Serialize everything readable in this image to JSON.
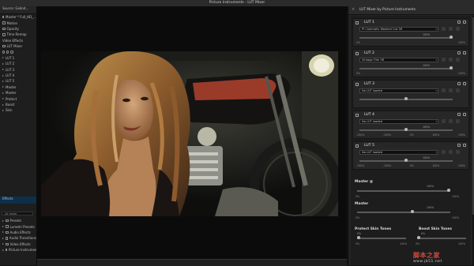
{
  "window": {
    "title": "Picture Instruments - LUT Mixer"
  },
  "left_panel": {
    "header": "Source: Geänd...",
    "items": [
      {
        "label": "Master * Full_HD_...",
        "kind": "fx"
      },
      {
        "label": "Motion",
        "kind": "fx"
      },
      {
        "label": "Opacity",
        "kind": "fx"
      },
      {
        "label": "Time Remap",
        "kind": "fx"
      },
      {
        "label": "Video Effects",
        "kind": "text"
      },
      {
        "label": "LUT Mixer",
        "kind": "fx"
      },
      {
        "label": "",
        "kind": "circles"
      },
      {
        "label": "LUT 1",
        "kind": "tri"
      },
      {
        "label": "LUT 2",
        "kind": "tri"
      },
      {
        "label": "LUT 3",
        "kind": "tri"
      },
      {
        "label": "LUT 4",
        "kind": "tri"
      },
      {
        "label": "LUT 5",
        "kind": "tri"
      },
      {
        "label": "Master",
        "kind": "tri"
      },
      {
        "label": "Master",
        "kind": "tri"
      },
      {
        "label": "Protect",
        "kind": "tri"
      },
      {
        "label": "Boost",
        "kind": "tri"
      },
      {
        "label": "Skin",
        "kind": "tri"
      }
    ],
    "lower_header": "Effects",
    "search_value": "lut mixer",
    "lower_items": [
      "Presets",
      "Lumetri Presets",
      "Audio Effects",
      "Audio Transitions",
      "Video Effects",
      "Picture Instruments"
    ]
  },
  "right_panel": {
    "title": "LUT Mixer by Picture Instruments",
    "close_glyph": "×",
    "luts": [
      {
        "name": "LUT 1",
        "selected": "PI Cinematic Washed Out 5R",
        "pct_top": "100%",
        "level": 1.0,
        "scale": [
          "0%",
          "",
          "",
          "",
          "100%"
        ]
      },
      {
        "name": "LUT 2",
        "selected": "Vintage Film 5R",
        "pct_top": "100%",
        "level": 1.0,
        "scale": [
          "0%",
          "",
          "",
          "",
          "100%"
        ]
      },
      {
        "name": "LUT 3",
        "selected": "No LUT loaded",
        "pct_top": "",
        "level": 0.5,
        "scale": [
          "",
          "",
          "",
          "",
          ""
        ]
      },
      {
        "name": "LUT 4",
        "selected": "No LUT loaded",
        "pct_top": "100%",
        "level": 0.5,
        "scale": [
          "-150%",
          "-100%",
          "0%",
          "100%",
          "150%"
        ]
      },
      {
        "name": "LUT 5",
        "selected": "No LUT loaded",
        "pct_top": "100%",
        "level": 0.5,
        "scale": [
          "-150%",
          "-100%",
          "0%",
          "100%",
          "150%"
        ]
      }
    ],
    "master_at": {
      "label": "Master @",
      "value": "100%",
      "scale_min": "0%",
      "scale_max": "100%",
      "level": 1.0
    },
    "master": {
      "label": "Master",
      "value": "100%",
      "scale_min": "0%",
      "scale_max": "100%",
      "level": 0.6
    },
    "protect": {
      "label": "Protect Skin Tones",
      "value": "0%",
      "scale_min": "0%",
      "scale_max": "100%",
      "level": 0.0
    },
    "boost": {
      "label": "Boost Skin Tones",
      "value": "0%",
      "scale_min": "0%",
      "scale_max": "100%",
      "level": 0.0
    }
  },
  "watermark": {
    "text": "脚本之家",
    "url": "www.jb51.net"
  }
}
